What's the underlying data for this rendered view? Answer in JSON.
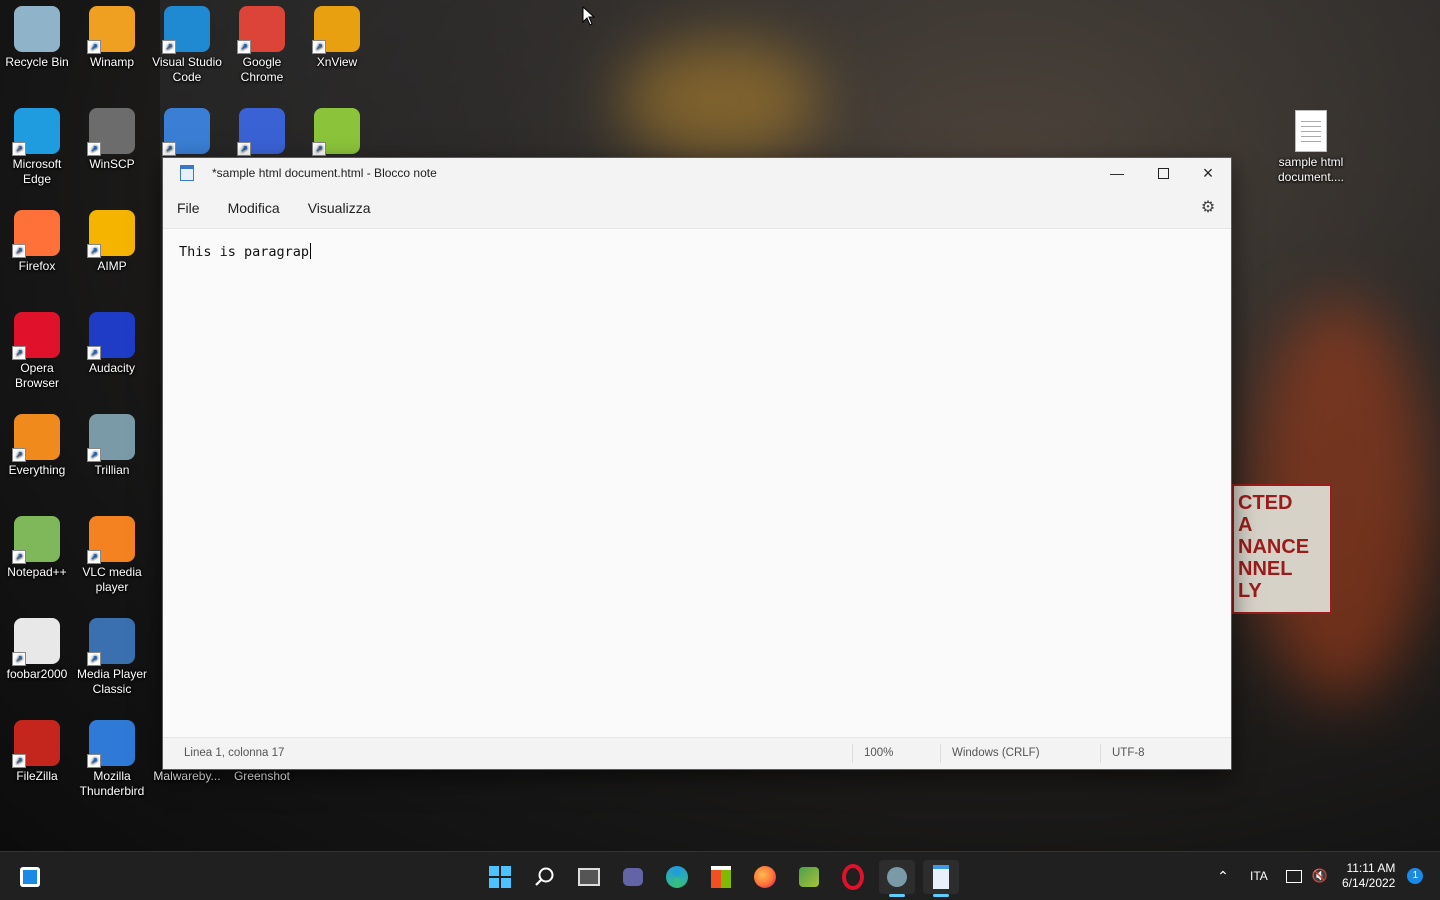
{
  "desktop": {
    "icons": [
      {
        "label": "Recycle Bin",
        "icon": "recycle-bin-icon",
        "color": "#8fb3c9"
      },
      {
        "label": "Winamp",
        "icon": "winamp-icon",
        "color": "#f0a020"
      },
      {
        "label": "Visual Studio Code",
        "icon": "vscode-icon",
        "color": "#1f8ad2"
      },
      {
        "label": "Google Chrome",
        "icon": "chrome-icon",
        "color": "#db4437"
      },
      {
        "label": "XnView",
        "icon": "xnview-icon",
        "color": "#e8a010"
      },
      {
        "label": "Microsoft Edge",
        "icon": "edge-icon",
        "color": "#1f9be0"
      },
      {
        "label": "WinSCP",
        "icon": "winscp-icon",
        "color": "#6c6c6c"
      },
      {
        "label": "",
        "icon": "openoffice-icon",
        "color": "#3a7fd5"
      },
      {
        "label": "",
        "icon": "network-icon",
        "color": "#3a62d5"
      },
      {
        "label": "",
        "icon": "peazip-icon",
        "color": "#8bc43a"
      },
      {
        "label": "Firefox",
        "icon": "firefox-icon",
        "color": "#ff7139"
      },
      {
        "label": "AIMP",
        "icon": "aimp-icon",
        "color": "#f4b400"
      },
      {
        "label": "Opera Browser",
        "icon": "opera-icon",
        "color": "#e0112b"
      },
      {
        "label": "Audacity",
        "icon": "audacity-icon",
        "color": "#1f3cc7"
      },
      {
        "label": "Everything",
        "icon": "everything-icon",
        "color": "#f08a1c"
      },
      {
        "label": "Trillian",
        "icon": "trillian-icon",
        "color": "#7a9aa8"
      },
      {
        "label": "Notepad++",
        "icon": "notepadpp-icon",
        "color": "#7fb85a"
      },
      {
        "label": "VLC media player",
        "icon": "vlc-icon",
        "color": "#f58220"
      },
      {
        "label": "foobar2000",
        "icon": "foobar-icon",
        "color": "#e8e8e8"
      },
      {
        "label": "Media Player Classic",
        "icon": "mpc-icon",
        "color": "#3a6fb0"
      },
      {
        "label": "FileZilla",
        "icon": "filezilla-icon",
        "color": "#c4261d"
      },
      {
        "label": "Mozilla Thunderbird",
        "icon": "thunderbird-icon",
        "color": "#2f7ad6"
      },
      {
        "label": "Malwareby...",
        "icon": "malwarebytes-icon",
        "color": "#2a5ac8"
      },
      {
        "label": "Greenshot",
        "icon": "greenshot-icon",
        "color": "#4aa048"
      }
    ],
    "file": {
      "label": "sample html document....",
      "icon": "document-file-icon"
    }
  },
  "notepad": {
    "title": "*sample html document.html - Blocco note",
    "menu": [
      "File",
      "Modifica",
      "Visualizza"
    ],
    "content": "This is paragrap",
    "status": {
      "position": "Linea 1, colonna 17",
      "zoom": "100%",
      "line_ending": "Windows (CRLF)",
      "encoding": "UTF-8"
    }
  },
  "taskbar": {
    "language": "ITA",
    "time": "11:11 AM",
    "date": "6/14/2022",
    "notifications": "1",
    "accent": "#60cdff"
  }
}
